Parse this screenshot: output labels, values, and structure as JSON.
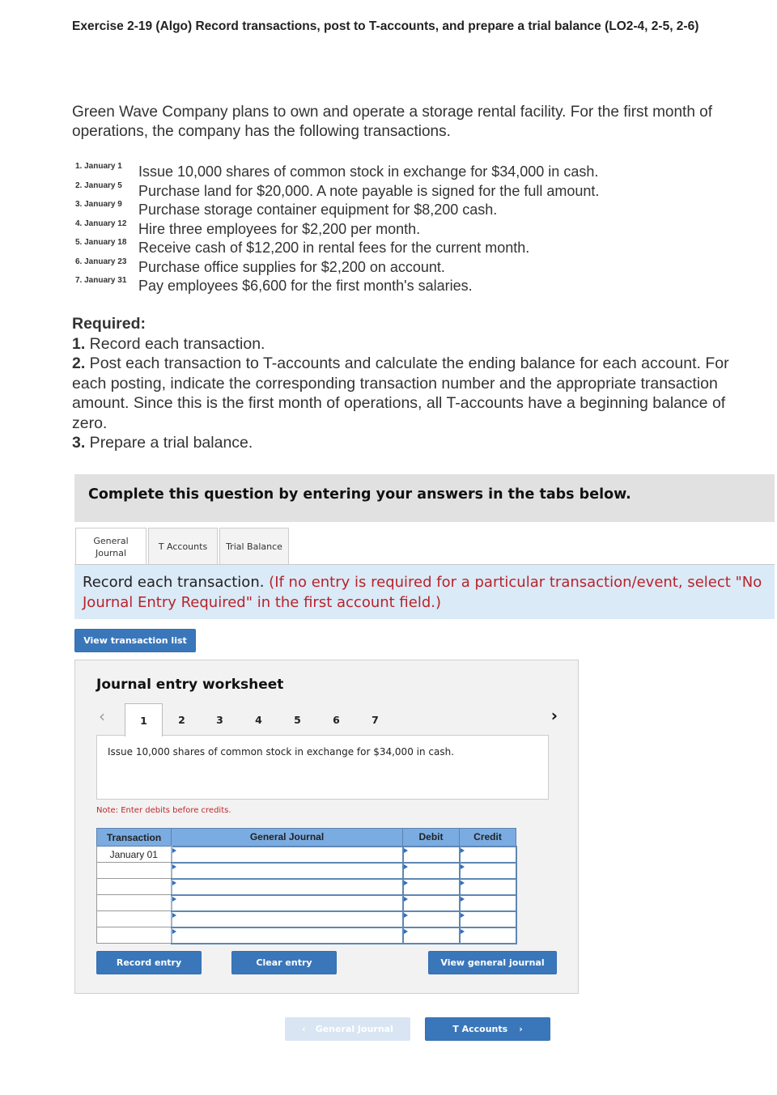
{
  "title": "Exercise 2-19 (Algo) Record transactions, post to T-accounts, and prepare a trial balance (LO2-4, 2-5, 2-6)",
  "intro": "Green Wave Company plans to own and operate a storage rental facility. For the first month of operations, the company has the following transactions.",
  "transactions": [
    {
      "num": "1. January 1",
      "desc": "Issue 10,000 shares of common stock in exchange for $34,000 in cash."
    },
    {
      "num": "2. January 5",
      "desc": "Purchase land for $20,000. A note payable is signed for the full amount."
    },
    {
      "num": "3. January 9",
      "desc": "Purchase storage container equipment for $8,200 cash."
    },
    {
      "num": "4. January 12",
      "desc": "Hire three employees for $2,200 per month."
    },
    {
      "num": "5. January 18",
      "desc": "Receive cash of $12,200 in rental fees for the current month."
    },
    {
      "num": "6. January 23",
      "desc": "Purchase office supplies for $2,200 on account."
    },
    {
      "num": "7. January 31",
      "desc": "Pay employees $6,600 for the first month's salaries."
    }
  ],
  "required": {
    "heading": "Required:",
    "items": [
      {
        "num": "1.",
        "text": " Record each transaction."
      },
      {
        "num": "2.",
        "text": " Post each transaction to T-accounts and calculate the ending balance for each account. For each posting, indicate the corresponding transaction number and the appropriate transaction amount. Since this is the first month of operations, all T-accounts have a beginning balance of zero."
      },
      {
        "num": "3.",
        "text": " Prepare a trial balance."
      }
    ]
  },
  "complete_bar": "Complete this question by entering your answers in the tabs below.",
  "tabs": [
    {
      "label_line1": "General",
      "label_line2": "Journal",
      "active": true
    },
    {
      "label_line1": "T Accounts",
      "label_line2": "",
      "active": false
    },
    {
      "label_line1": "Trial Balance",
      "label_line2": "",
      "active": false
    }
  ],
  "instruction": {
    "main": "Record each transaction. ",
    "note": "(If no entry is required for a particular transaction/event, select \"No Journal Entry Required\" in the first account field.)"
  },
  "view_transaction_list": "View transaction list",
  "worksheet": {
    "title": "Journal entry worksheet",
    "pages": [
      "1",
      "2",
      "3",
      "4",
      "5",
      "6",
      "7"
    ],
    "active_page": "1",
    "description": "Issue 10,000 shares of common stock in exchange for $34,000 in cash.",
    "note": "Note: Enter debits before credits.",
    "table": {
      "headers": [
        "Transaction",
        "General Journal",
        "Debit",
        "Credit"
      ],
      "rows": [
        {
          "transaction": "January 01",
          "account": "",
          "debit": "",
          "credit": ""
        },
        {
          "transaction": "",
          "account": "",
          "debit": "",
          "credit": ""
        },
        {
          "transaction": "",
          "account": "",
          "debit": "",
          "credit": ""
        },
        {
          "transaction": "",
          "account": "",
          "debit": "",
          "credit": ""
        },
        {
          "transaction": "",
          "account": "",
          "debit": "",
          "credit": ""
        },
        {
          "transaction": "",
          "account": "",
          "debit": "",
          "credit": ""
        }
      ]
    },
    "buttons": {
      "record": "Record entry",
      "clear": "Clear entry",
      "view_journal": "View general journal"
    }
  },
  "nav": {
    "prev": "General Journal",
    "next": "T Accounts"
  },
  "colors": {
    "button_blue": "#3a77ba",
    "header_blue": "#7aace2",
    "instruction_bg": "#dbeaf7",
    "error_red": "#b8232b"
  }
}
